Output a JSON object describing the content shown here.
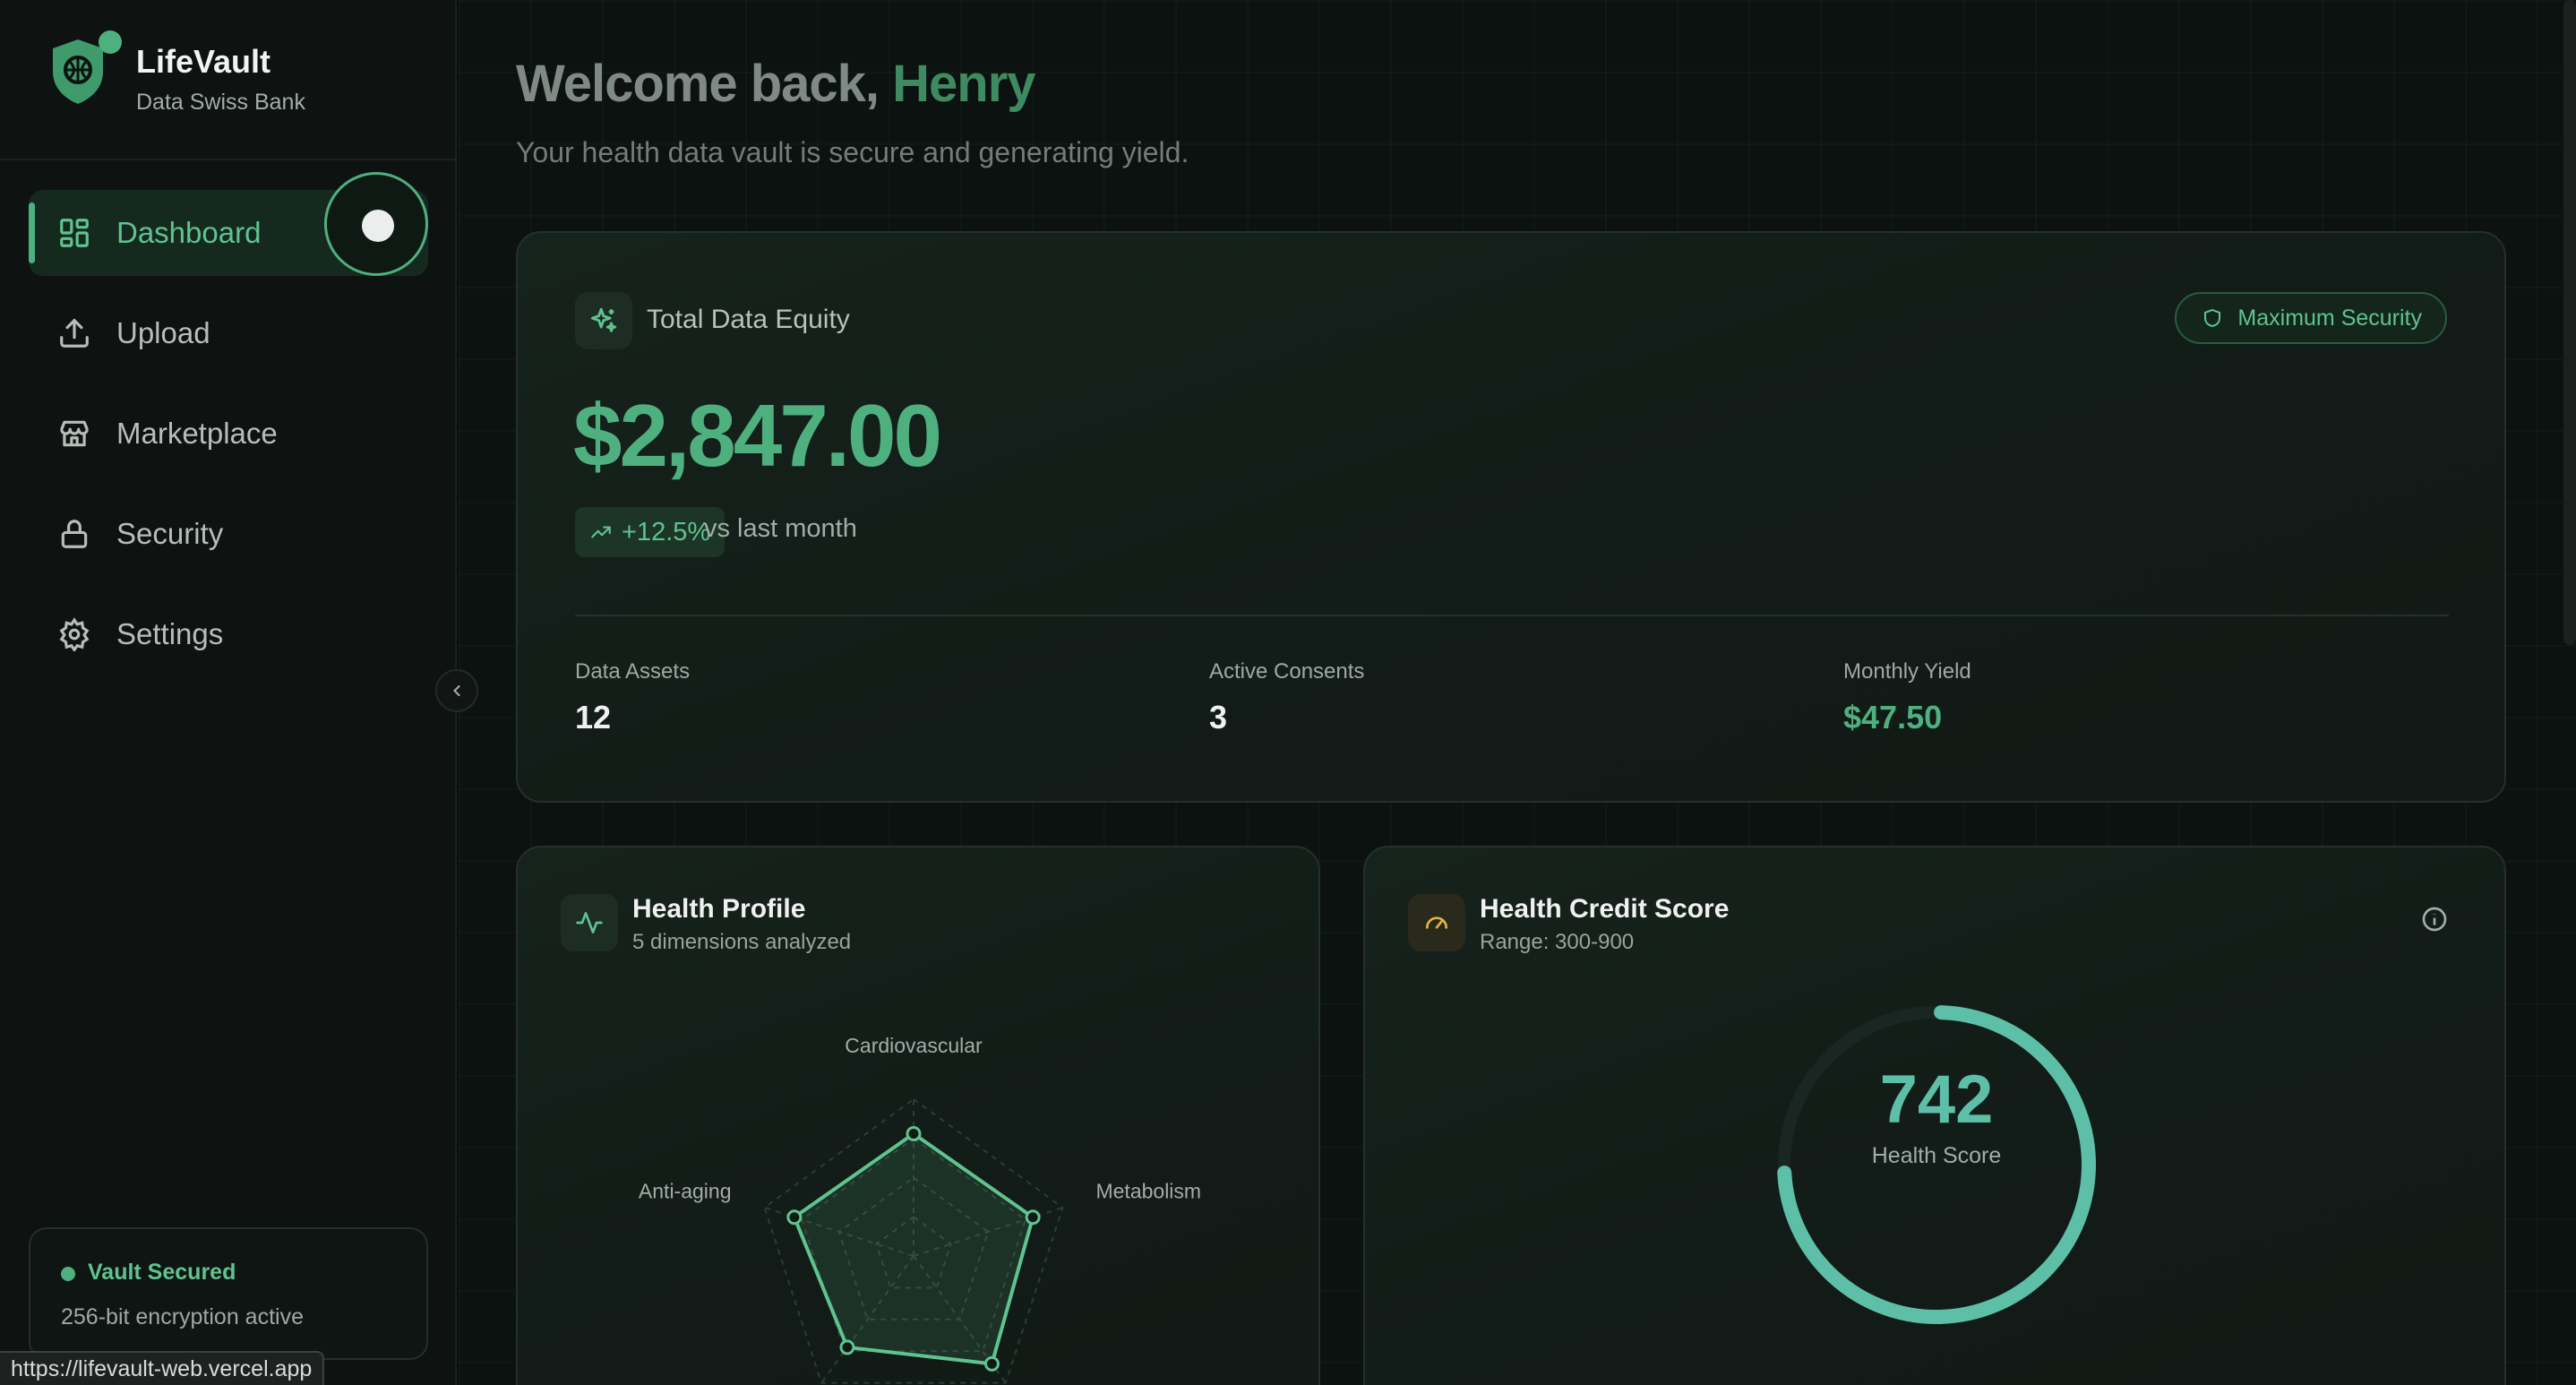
{
  "brand": {
    "name": "LifeVault",
    "tagline": "Data Swiss Bank"
  },
  "nav": {
    "items": [
      {
        "label": "Dashboard",
        "icon": "dashboard-grid-icon",
        "active": true
      },
      {
        "label": "Upload",
        "icon": "upload-icon",
        "active": false
      },
      {
        "label": "Marketplace",
        "icon": "store-icon",
        "active": false
      },
      {
        "label": "Security",
        "icon": "lock-icon",
        "active": false
      },
      {
        "label": "Settings",
        "icon": "gear-icon",
        "active": false
      }
    ]
  },
  "vault_status": {
    "title": "Vault Secured",
    "detail": "256-bit encryption active"
  },
  "status_url": "https://lifevault-web.vercel.app",
  "header": {
    "greeting": "Welcome back,",
    "user_name": "Henry",
    "subtitle": "Your health data vault is secure and generating yield."
  },
  "equity": {
    "label": "Total Data Equity",
    "security_badge": "Maximum Security",
    "value": "$2,847.00",
    "change": "+12.5%",
    "change_note": "vs last month",
    "stats": [
      {
        "label": "Data Assets",
        "value": "12"
      },
      {
        "label": "Active Consents",
        "value": "3"
      },
      {
        "label": "Monthly Yield",
        "value": "$47.50"
      }
    ]
  },
  "health_profile": {
    "title": "Health Profile",
    "subtitle": "5 dimensions analyzed",
    "chart_data": {
      "type": "radar",
      "axes": [
        "Cardiovascular",
        "Metabolism",
        "",
        "",
        "Anti-aging"
      ],
      "values": [
        0.78,
        0.8,
        0.85,
        0.72,
        0.8
      ],
      "rings": 4
    }
  },
  "credit_score": {
    "title": "Health Credit Score",
    "subtitle": "Range: 300-900",
    "score": "742",
    "score_label": "Health Score",
    "range_min": 300,
    "range_max": 900,
    "score_value": 742
  },
  "colors": {
    "accent": "#4fb07f",
    "score": "#5ebfa8",
    "background": "#0b0f0d",
    "gauge_icon": "#e3b341"
  }
}
